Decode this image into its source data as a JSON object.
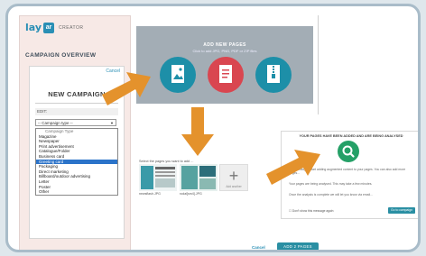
{
  "logo": {
    "brand_lay": "lay",
    "brand_ar": "ar",
    "product": "CREATOR"
  },
  "sidebar": {
    "title": "CAMPAIGN OVERVIEW"
  },
  "new_campaign": {
    "cancel_label": "Cancel",
    "title": "NEW CAMPAIGN",
    "edit_label": "EDIT:",
    "select_value": "-- Campaign type --",
    "options": [
      "Campaign Type",
      "Magazine",
      "Newspaper",
      "Print advertisement",
      "Catalogue/Folder",
      "Business card",
      "Greeting card",
      "Packaging",
      "Direct marketing",
      "Billboard/outdoor advertising",
      "Letter",
      "Poster",
      "Other"
    ],
    "selected_index": 6
  },
  "upload": {
    "title": "ADD NEW PAGES",
    "subtitle": "Click to add JPG, PNG, PDF or ZIP files"
  },
  "thumbnails": {
    "select_line": "Select the pages you want to add ...",
    "items": [
      {
        "caption": "newsflash.JPG"
      },
      {
        "caption": "rodal[sm4].JPG"
      }
    ],
    "add_caption": "Add another"
  },
  "analysis": {
    "heading": "YOUR PAGES HAVE BEEN ADDED AND ARE BEING ANALYSED",
    "p1": "You're ready to start adding augmented content to your pages. You can also add more pages...",
    "p2": "Your pages are being analysed. This may take a few minutes.",
    "p3": "Once the analysis is complete we will let you know via email...",
    "checkbox_label": "Don't show this message again",
    "button": "Go to campaign"
  },
  "footer": {
    "cancel": "Cancel",
    "add_pages": "ADD 2 PAGES"
  },
  "colors": {
    "accent": "#2a8fb5",
    "arrow": "#e4922c",
    "blue_file": "#1d8fa8",
    "red_file": "#d94650",
    "green_file": "#25a067"
  },
  "icons": [
    "image-file-icon",
    "pdf-file-icon",
    "zip-file-icon",
    "search-icon",
    "plus-icon"
  ]
}
